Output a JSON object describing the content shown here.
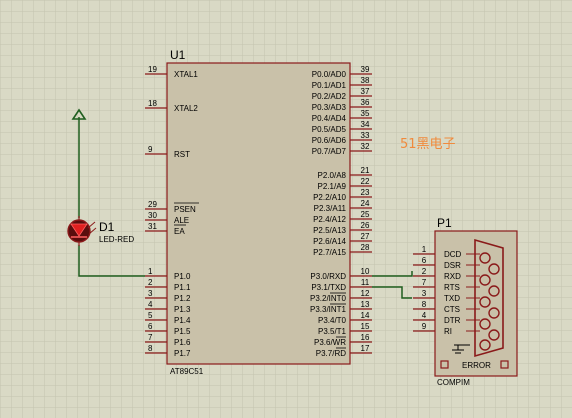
{
  "u1": {
    "ref": "U1",
    "part": "AT89C51",
    "left_pins": [
      {
        "num": "19",
        "name": "XTAL1"
      },
      {
        "num": "18",
        "name": "XTAL2"
      },
      {
        "num": "9",
        "name": "RST"
      },
      {
        "num": "29",
        "name": "PSEN"
      },
      {
        "num": "30",
        "name": "ALE"
      },
      {
        "num": "31",
        "name": "EA"
      },
      {
        "num": "1",
        "name": "P1.0"
      },
      {
        "num": "2",
        "name": "P1.1"
      },
      {
        "num": "3",
        "name": "P1.2"
      },
      {
        "num": "4",
        "name": "P1.3"
      },
      {
        "num": "5",
        "name": "P1.4"
      },
      {
        "num": "6",
        "name": "P1.5"
      },
      {
        "num": "7",
        "name": "P1.6"
      },
      {
        "num": "8",
        "name": "P1.7"
      }
    ],
    "right_pins": [
      {
        "num": "39",
        "name": "P0.0/AD0"
      },
      {
        "num": "38",
        "name": "P0.1/AD1"
      },
      {
        "num": "37",
        "name": "P0.2/AD2"
      },
      {
        "num": "36",
        "name": "P0.3/AD3"
      },
      {
        "num": "35",
        "name": "P0.4/AD4"
      },
      {
        "num": "34",
        "name": "P0.5/AD5"
      },
      {
        "num": "33",
        "name": "P0.6/AD6"
      },
      {
        "num": "32",
        "name": "P0.7/AD7"
      },
      {
        "num": "21",
        "name": "P2.0/A8"
      },
      {
        "num": "22",
        "name": "P2.1/A9"
      },
      {
        "num": "23",
        "name": "P2.2/A10"
      },
      {
        "num": "24",
        "name": "P2.3/A11"
      },
      {
        "num": "25",
        "name": "P2.4/A12"
      },
      {
        "num": "26",
        "name": "P2.5/A13"
      },
      {
        "num": "27",
        "name": "P2.6/A14"
      },
      {
        "num": "28",
        "name": "P2.7/A15"
      },
      {
        "num": "10",
        "name": "P3.0/RXD"
      },
      {
        "num": "11",
        "name": "P3.1/TXD"
      },
      {
        "num": "12",
        "name": "P3.2/INT0"
      },
      {
        "num": "13",
        "name": "P3.3/INT1"
      },
      {
        "num": "14",
        "name": "P3.4/T0"
      },
      {
        "num": "15",
        "name": "P3.5/T1"
      },
      {
        "num": "16",
        "name": "P3.6/WR"
      },
      {
        "num": "17",
        "name": "P3.7/RD"
      }
    ]
  },
  "d1": {
    "ref": "D1",
    "value": "LED-RED"
  },
  "p1": {
    "ref": "P1",
    "part": "COMPIM",
    "error_label": "ERROR",
    "pins": [
      {
        "num": "1",
        "name": "DCD"
      },
      {
        "num": "6",
        "name": "DSR"
      },
      {
        "num": "2",
        "name": "RXD"
      },
      {
        "num": "7",
        "name": "RTS"
      },
      {
        "num": "3",
        "name": "TXD"
      },
      {
        "num": "8",
        "name": "CTS"
      },
      {
        "num": "4",
        "name": "DTR"
      },
      {
        "num": "9",
        "name": "RI"
      }
    ]
  },
  "watermark": "51黑电子",
  "colors": {
    "background": "#d9d9c5",
    "grid": "#c4c4ae",
    "ic_body": "#c9c1a9",
    "component_outline": "#8a1a1a",
    "wire": "#1f5e1f",
    "watermark": "#f08a3c"
  }
}
